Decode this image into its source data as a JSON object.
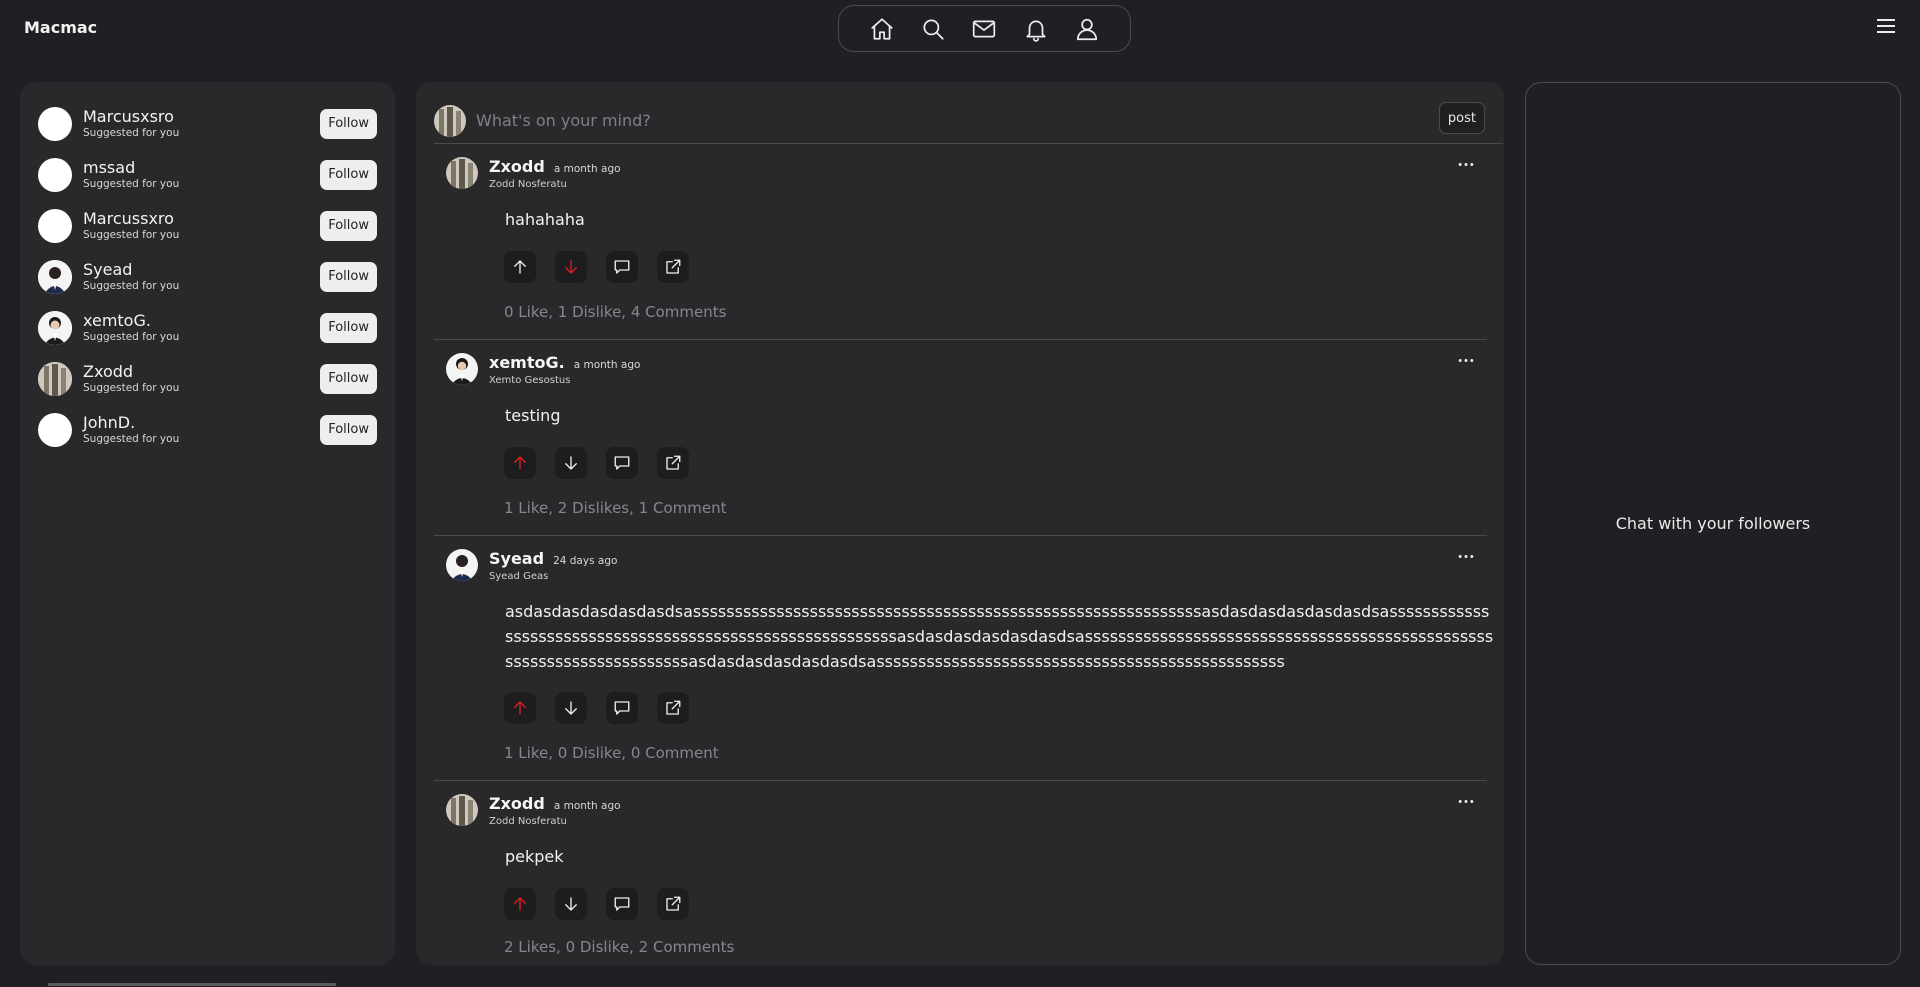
{
  "brand": "Macmac",
  "nav": {
    "icons": [
      "home-icon",
      "search-icon",
      "mail-icon",
      "bell-icon",
      "user-icon"
    ]
  },
  "menu_icon": "hamburger-icon",
  "suggestions": [
    {
      "name": "Marcusxsro",
      "sub": "Suggested for you",
      "follow": "Follow"
    },
    {
      "name": "mssad",
      "sub": "Suggested for you",
      "follow": "Follow"
    },
    {
      "name": "Marcussxro",
      "sub": "Suggested for you",
      "follow": "Follow"
    },
    {
      "name": "Syead",
      "sub": "Suggested for you",
      "follow": "Follow"
    },
    {
      "name": "xemtoG.",
      "sub": "Suggested for you",
      "follow": "Follow"
    },
    {
      "name": "Zxodd",
      "sub": "Suggested for you",
      "follow": "Follow"
    },
    {
      "name": "JohnD.",
      "sub": "Suggested for you",
      "follow": "Follow"
    }
  ],
  "composer": {
    "placeholder": "What's on your mind?",
    "post_label": "post"
  },
  "posts": [
    {
      "name": "Zxodd",
      "time": "a month ago",
      "handle": "Zodd Nosferatu",
      "text": "hahahaha",
      "vote": "down",
      "stats": "0 Like, 1 Dislike, 4 Comments"
    },
    {
      "name": "xemtoG.",
      "time": "a month ago",
      "handle": "Xemto Gesostus",
      "text": "testing",
      "vote": "up",
      "stats": "1 Like, 2 Dislikes, 1 Comment"
    },
    {
      "name": "Syead",
      "time": "24 days ago",
      "handle": "Syead Geas",
      "text": "asdasdasdasdasdasdsasssssssssssssssssssssssssssssssssssssssssssssssssssssssssssssasdasdasdasdasdasdsasssssssssssssssssssssssssssssssssssssssssssssssssssssssssssasdasdasdasdasdasdsasssssssssssssssssssssssssssssssssssssssssssssssssssssssssssssssssssssssasdasdasdasdasdasdsasssssssssssssssssssssssssssssssssssssssssssssssss",
      "vote": "up",
      "stats": "1 Like, 0 Dislike, 0 Comment"
    },
    {
      "name": "Zxodd",
      "time": "a month ago",
      "handle": "Zodd Nosferatu",
      "text": "pekpek",
      "vote": "up",
      "stats": "2 Likes, 0 Dislike, 2 Comments"
    }
  ],
  "chat": {
    "text": "Chat with your followers"
  },
  "colors": {
    "background": "#1f2023",
    "panel": "#29292b",
    "active_vote": "#e02020"
  }
}
